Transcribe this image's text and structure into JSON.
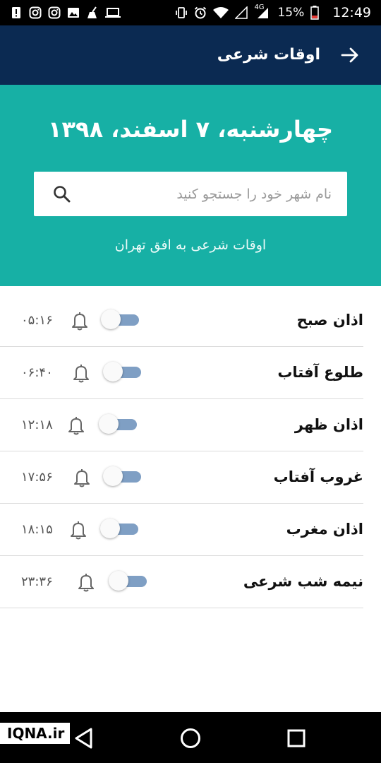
{
  "status_bar": {
    "battery": "15%",
    "time": "12:49",
    "network": "4G",
    "left_icons": [
      "alert-icon",
      "instagram-icon",
      "instagram-icon",
      "image-icon",
      "broom-icon",
      "laptop-icon"
    ],
    "right_icons": [
      "vibrate-icon",
      "alarm-icon",
      "wifi-icon",
      "signal-icon",
      "signal-4g-icon",
      "battery-low-icon"
    ]
  },
  "app_bar": {
    "title": "اوقات شرعی",
    "back_icon": "arrow-right-icon"
  },
  "header": {
    "date": "چهارشنبه، ۷ اسفند، ۱۳۹۸",
    "search_placeholder": "نام شهر خود را جستجو کنید",
    "search_value": "",
    "search_icon": "search-icon",
    "horizon_label": "اوقات شرعی به افق تهران"
  },
  "prayers": [
    {
      "name": "اذان صبح",
      "time": "۰۵:۱۶",
      "enabled": false
    },
    {
      "name": "طلوع آفتاب",
      "time": "۰۶:۴۰",
      "enabled": false
    },
    {
      "name": "اذان ظهر",
      "time": "۱۲:۱۸",
      "enabled": false
    },
    {
      "name": "غروب آفتاب",
      "time": "۱۷:۵۶",
      "enabled": false
    },
    {
      "name": "اذان مغرب",
      "time": "۱۸:۱۵",
      "enabled": false
    },
    {
      "name": "نیمه شب شرعی",
      "time": "۲۳:۳۶",
      "enabled": false
    }
  ],
  "nav_bar": {
    "watermark": "IQNA.ir",
    "icons": [
      "back-triangle-icon",
      "home-circle-icon",
      "recents-square-icon"
    ]
  },
  "colors": {
    "app_bar": "#0b2a52",
    "header": "#17b0a5",
    "toggle_track": "#7f9fc4"
  }
}
